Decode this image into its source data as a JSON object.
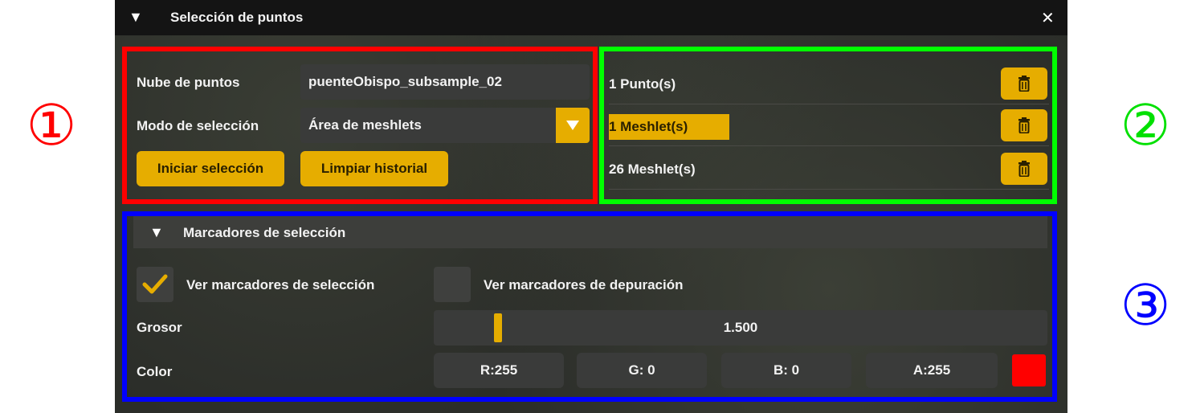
{
  "window": {
    "title": "Selección de puntos",
    "collapse_glyph": "▼",
    "close_glyph": "✕"
  },
  "selection": {
    "cloud_label": "Nube de puntos",
    "cloud_value": "puenteObispo_subsample_02",
    "mode_label": "Modo de selección",
    "mode_value": "Área de meshlets",
    "start_button": "Iniciar selección",
    "clear_button": "Limpiar historial"
  },
  "history": {
    "items": [
      {
        "label": "1 Punto(s)",
        "selected": false
      },
      {
        "label": "1 Meshlet(s)",
        "selected": true
      },
      {
        "label": "26 Meshlet(s)",
        "selected": false
      }
    ],
    "delete_icon": "trash-icon"
  },
  "markers": {
    "header": "Marcadores de selección",
    "show_selection_label": "Ver marcadores de selección",
    "show_selection_checked": true,
    "show_debug_label": "Ver marcadores de depuración",
    "show_debug_checked": false,
    "thickness_label": "Grosor",
    "thickness_value": "1.500",
    "thickness_fraction": 0.1,
    "color_label": "Color",
    "color_r": "R:255",
    "color_g": "G: 0",
    "color_b": "B: 0",
    "color_a": "A:255",
    "swatch_color": "#ff0000"
  },
  "annotations": {
    "badge_1": "①",
    "badge_2": "②",
    "badge_3": "③",
    "badge_1_color": "#ff0000",
    "badge_2_color": "#00e000",
    "badge_3_color": "#0000ff"
  },
  "colors": {
    "accent": "#e6ad00",
    "panel": "#2b2d29",
    "titlebar": "#141414"
  }
}
